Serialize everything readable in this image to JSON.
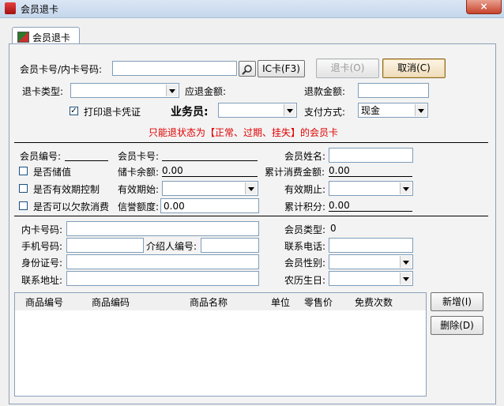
{
  "window": {
    "title": "会员退卡",
    "close_label": "×"
  },
  "tab": {
    "label": "会员退卡"
  },
  "top": {
    "card_no_label": "会员卡号/内卡号码:",
    "card_no_value": "",
    "ic_button": "IC卡(F3)",
    "refund_button": "退卡(O)",
    "cancel_button": "取消(C)",
    "refund_type_label": "退卡类型:",
    "refund_type_value": "",
    "should_refund_label": "应退金额:",
    "refund_amount_label": "退款金额:",
    "refund_amount_value": "",
    "print_voucher_label": "打印退卡凭证",
    "print_voucher_checked": true,
    "salesman_label": "业务员:",
    "salesman_value": "",
    "payment_label": "支付方式:",
    "payment_value": "现金",
    "notice": "只能退状态为【正常、过期、挂失】的会员卡"
  },
  "member": {
    "member_id_label": "会员编号:",
    "member_card_label": "会员卡号:",
    "member_name_label": "会员姓名:",
    "stored_value_label": "是否储值",
    "stored_balance_label": "储卡余额:",
    "stored_balance_value": "0.00",
    "total_consume_label": "累计消费金额:",
    "total_consume_value": "0.00",
    "validity_control_label": "是否有效期控制",
    "valid_start_label": "有效期始:",
    "valid_end_label": "有效期止:",
    "credit_label": "是否可以欠款消费",
    "credit_limit_label": "信誉额度:",
    "credit_limit_value": "0.00",
    "total_points_label": "累计积分:",
    "total_points_value": "0.00"
  },
  "detail": {
    "inner_card_label": "内卡号码:",
    "member_type_label": "会员类型:",
    "member_type_value": "0",
    "phone_label": "手机号码:",
    "referrer_label": "介绍人编号:",
    "contact_phone_label": "联系电话:",
    "id_card_label": "身份证号:",
    "gender_label": "会员性别:",
    "address_label": "联系地址:",
    "birthday_label": "农历生日:"
  },
  "grid": {
    "columns": [
      "商品编号",
      "商品编码",
      "商品名称",
      "单位",
      "零售价",
      "免费次数"
    ]
  },
  "side_buttons": {
    "add": "新增(I)",
    "delete": "删除(D)"
  }
}
